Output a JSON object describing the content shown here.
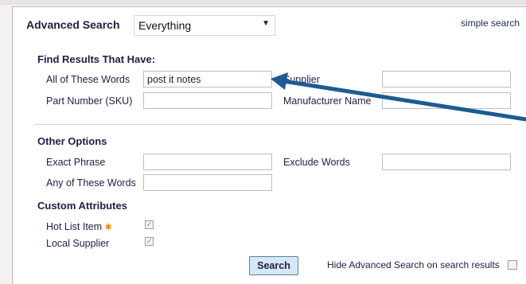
{
  "header": {
    "title": "Advanced Search",
    "scope_value": "Everything",
    "simple_link": "simple search"
  },
  "find_section": {
    "heading": "Find Results That Have:",
    "all_words_label": "All of These Words",
    "all_words_value": "post it notes",
    "part_number_label": "Part Number (SKU)",
    "part_number_value": "",
    "supplier_label": "Supplier",
    "supplier_value": "",
    "manufacturer_label": "Manufacturer Name",
    "manufacturer_value": ""
  },
  "other_section": {
    "heading": "Other Options",
    "exact_phrase_label": "Exact Phrase",
    "exact_phrase_value": "",
    "exclude_label": "Exclude Words",
    "exclude_value": "",
    "any_words_label": "Any of These Words",
    "any_words_value": ""
  },
  "custom_section": {
    "heading": "Custom Attributes",
    "hot_list_label": "Hot List Item",
    "local_supplier_label": "Local Supplier"
  },
  "footer": {
    "search_button": "Search",
    "hide_label": "Hide Advanced Search on search results"
  },
  "colors": {
    "arrow": "#1f5a93",
    "star": "#f08a12"
  },
  "icons": {
    "select_arrow": "caret-down-icon",
    "hot_list_marker": "star-icon"
  }
}
